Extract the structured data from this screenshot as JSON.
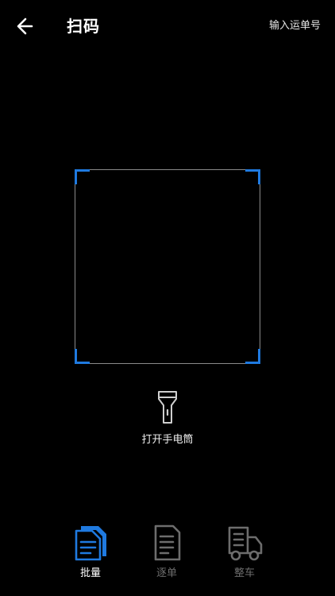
{
  "header": {
    "title": "扫码",
    "back_icon": "arrow-left-icon",
    "manual_entry_label": "输入运单号"
  },
  "scanner": {
    "corner_color": "#1f7ae0",
    "border_color": "#8a8a8a"
  },
  "flashlight": {
    "icon": "flashlight-icon",
    "label": "打开手电筒"
  },
  "bottom_nav": {
    "active_color": "#1f7ae0",
    "inactive_color": "#6d6d6d",
    "items": [
      {
        "label": "批量",
        "icon": "documents-stack-icon",
        "active": true
      },
      {
        "label": "逐单",
        "icon": "document-icon",
        "active": false
      },
      {
        "label": "整车",
        "icon": "truck-icon",
        "active": false
      }
    ]
  }
}
